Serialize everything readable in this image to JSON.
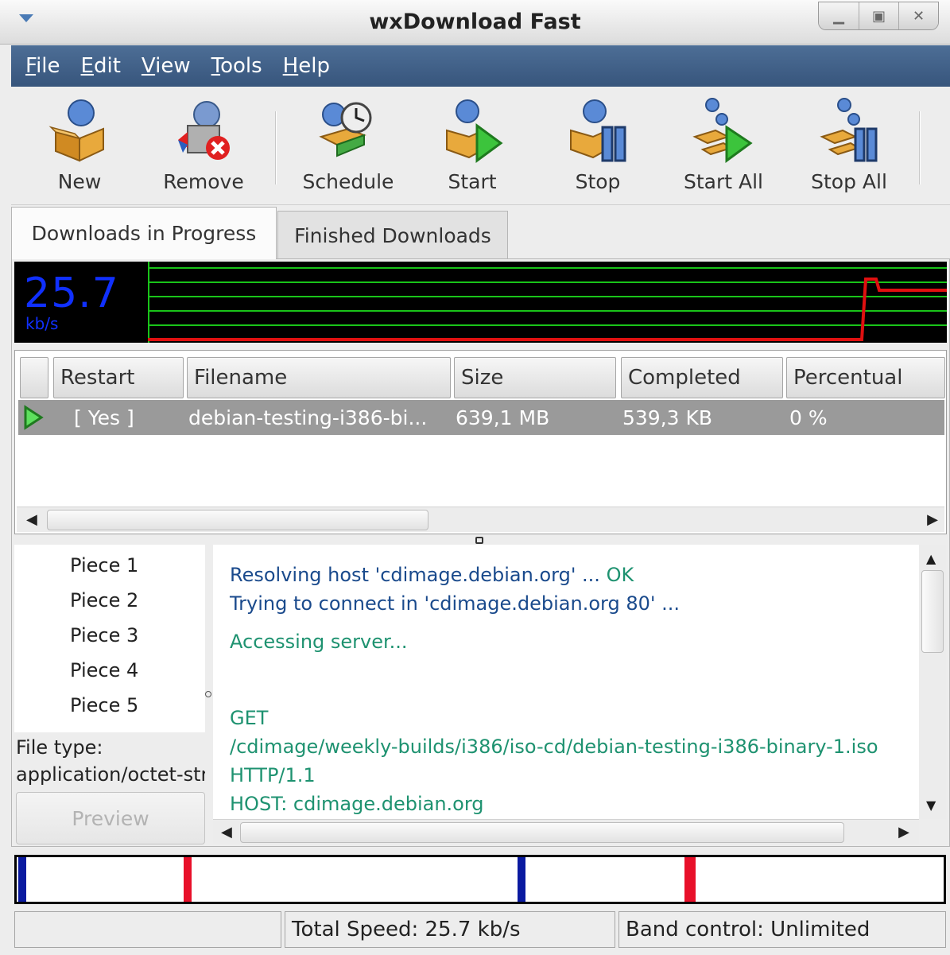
{
  "window": {
    "title": "wxDownload Fast"
  },
  "menu": [
    {
      "accel": "F",
      "rest": "ile"
    },
    {
      "accel": "E",
      "rest": "dit"
    },
    {
      "accel": "V",
      "rest": "iew"
    },
    {
      "accel": "T",
      "rest": "ools"
    },
    {
      "accel": "H",
      "rest": "elp"
    }
  ],
  "toolbar": {
    "new": "New",
    "remove": "Remove",
    "schedule": "Schedule",
    "start": "Start",
    "stop": "Stop",
    "start_all": "Start All",
    "stop_all": "Stop All"
  },
  "tabs": {
    "in_progress": "Downloads in Progress",
    "finished": "Finished Downloads"
  },
  "graph": {
    "speed": "25.7",
    "unit": "kb/s"
  },
  "table": {
    "headers": {
      "restart": "Restart",
      "filename": "Filename",
      "size": "Size",
      "completed": "Completed",
      "percentual": "Percentual"
    },
    "rows": [
      {
        "restart": "[ Yes ]",
        "filename": "debian-testing-i386-bi...",
        "size": "639,1 MB",
        "completed": "539,3 KB",
        "percentual": "0 %"
      }
    ]
  },
  "pieces": [
    "Piece 1",
    "Piece 2",
    "Piece 3",
    "Piece 4",
    "Piece 5"
  ],
  "file_type": {
    "label": "File type:",
    "value": "application/octet-stream"
  },
  "preview_label": "Preview",
  "log": {
    "resolving": "Resolving host 'cdimage.debian.org' ... ",
    "ok": "OK",
    "trying": "Trying to connect in 'cdimage.debian.org 80' ...",
    "accessing": "Accessing server...",
    "get": "GET",
    "path": "/cdimage/weekly-builds/i386/iso-cd/debian-testing-i386-binary-1.iso",
    "http": "HTTP/1.1",
    "host": "HOST: cdimage.debian.org"
  },
  "statusbar": {
    "total_speed": "Total Speed: 25.7 kb/s",
    "band_control": "Band control: Unlimited"
  },
  "colors": {
    "menubar": "#3f5f88",
    "log_blue": "#1a4a8c",
    "log_green": "#1e9270",
    "graph_grid": "#19c419",
    "graph_line": "#e01010"
  }
}
